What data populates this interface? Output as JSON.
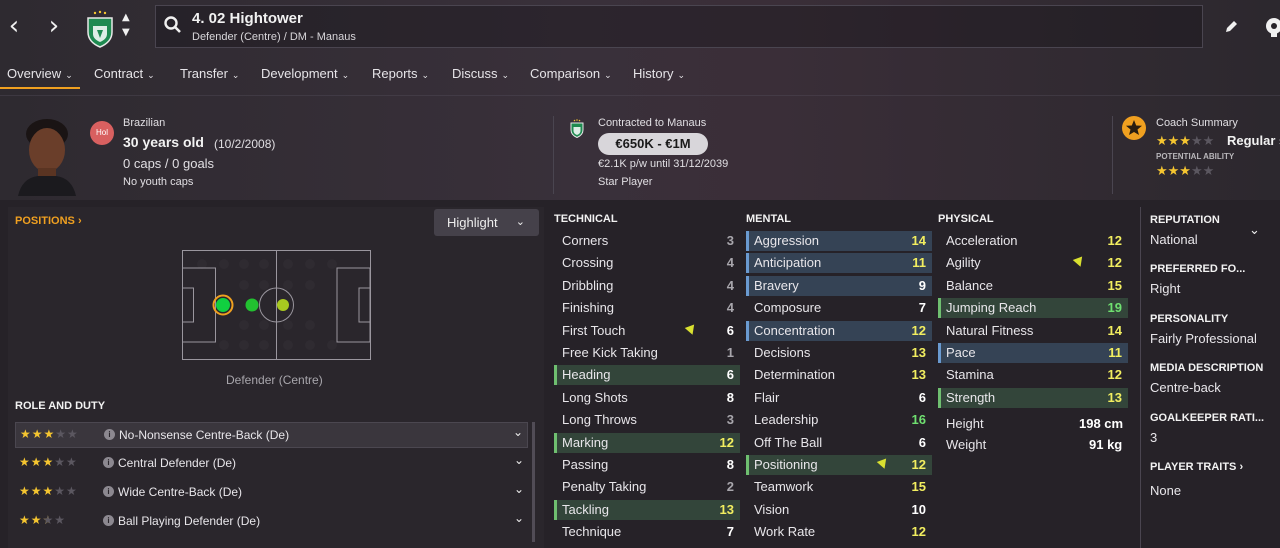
{
  "header": {
    "player_title": "4. 02 Hightower",
    "player_subtitle": "Defender (Centre) / DM - Manaus",
    "back_icon": "chevron-left-icon",
    "forward_icon": "chevron-right-icon"
  },
  "menu": {
    "items": [
      {
        "label": "Overview"
      },
      {
        "label": "Contract"
      },
      {
        "label": "Transfer"
      },
      {
        "label": "Development"
      },
      {
        "label": "Reports"
      },
      {
        "label": "Discuss"
      },
      {
        "label": "Comparison"
      },
      {
        "label": "History"
      }
    ],
    "active": "Overview"
  },
  "profile": {
    "nationality": "Brazilian",
    "nation_badge": "Hol",
    "age": "30 years old",
    "dob": "(10/2/2008)",
    "caps": "0 caps / 0 goals",
    "youth": "No youth caps"
  },
  "contract": {
    "heading": "Contracted to Manaus",
    "value": "€650K - €1M",
    "wage": "€2.1K p/w until 31/12/2039",
    "status": "Star Player"
  },
  "coach": {
    "heading": "Coach Summary",
    "ability_stars": 3,
    "ability_label": "Regular s",
    "potential_heading": "POTENTIAL ABILITY",
    "potential_stars": 3
  },
  "positions": {
    "heading": "POSITIONS",
    "highlight_label": "Highlight",
    "pitch_caption": "Defender (Centre)",
    "marker_colors": {
      "natural": "#10d040",
      "accomplished": "#22c030",
      "competent": "#a8c820"
    }
  },
  "roles": {
    "heading": "ROLE AND DUTY",
    "items": [
      {
        "label": "No-Nonsense Centre-Back (De)",
        "stars": 3
      },
      {
        "label": "Central Defender (De)",
        "stars": 3
      },
      {
        "label": "Wide Centre-Back (De)",
        "stars": 3
      },
      {
        "label": "Ball Playing Defender (De)",
        "stars": 2.5
      }
    ]
  },
  "technical": {
    "heading": "TECHNICAL",
    "items": [
      {
        "name": "Corners",
        "value": "3"
      },
      {
        "name": "Crossing",
        "value": "4"
      },
      {
        "name": "Dribbling",
        "value": "4"
      },
      {
        "name": "Finishing",
        "value": "4"
      },
      {
        "name": "First Touch",
        "value": "6"
      },
      {
        "name": "Free Kick Taking",
        "value": "1"
      },
      {
        "name": "Heading",
        "value": "6"
      },
      {
        "name": "Long Shots",
        "value": "8"
      },
      {
        "name": "Long Throws",
        "value": "3"
      },
      {
        "name": "Marking",
        "value": "12"
      },
      {
        "name": "Passing",
        "value": "8"
      },
      {
        "name": "Penalty Taking",
        "value": "2"
      },
      {
        "name": "Tackling",
        "value": "13"
      },
      {
        "name": "Technique",
        "value": "7"
      }
    ]
  },
  "mental": {
    "heading": "MENTAL",
    "items": [
      {
        "name": "Aggression",
        "value": "14"
      },
      {
        "name": "Anticipation",
        "value": "11"
      },
      {
        "name": "Bravery",
        "value": "9"
      },
      {
        "name": "Composure",
        "value": "7"
      },
      {
        "name": "Concentration",
        "value": "12"
      },
      {
        "name": "Decisions",
        "value": "13"
      },
      {
        "name": "Determination",
        "value": "13"
      },
      {
        "name": "Flair",
        "value": "6"
      },
      {
        "name": "Leadership",
        "value": "16"
      },
      {
        "name": "Off The Ball",
        "value": "6"
      },
      {
        "name": "Positioning",
        "value": "12"
      },
      {
        "name": "Teamwork",
        "value": "15"
      },
      {
        "name": "Vision",
        "value": "10"
      },
      {
        "name": "Work Rate",
        "value": "12"
      }
    ]
  },
  "physical": {
    "heading": "PHYSICAL",
    "items": [
      {
        "name": "Acceleration",
        "value": "12"
      },
      {
        "name": "Agility",
        "value": "12"
      },
      {
        "name": "Balance",
        "value": "15"
      },
      {
        "name": "Jumping Reach",
        "value": "19"
      },
      {
        "name": "Natural Fitness",
        "value": "14"
      },
      {
        "name": "Pace",
        "value": "11"
      },
      {
        "name": "Stamina",
        "value": "12"
      },
      {
        "name": "Strength",
        "value": "13"
      }
    ],
    "height_label": "Height",
    "height": "198 cm",
    "weight_label": "Weight",
    "weight": "91 kg"
  },
  "side": {
    "reputation_h": "REPUTATION",
    "reputation": "National",
    "foot_h": "PREFERRED FO...",
    "foot": "Right",
    "personality_h": "PERSONALITY",
    "personality": "Fairly Professional",
    "media_h": "MEDIA DESCRIPTION",
    "media": "Centre-back",
    "gk_h": "GOALKEEPER RATI...",
    "gk": "3",
    "traits_h": "PLAYER TRAITS",
    "traits": "None"
  },
  "colors": {
    "accent": "#f0a020",
    "value_white": "#ffffff",
    "value_grey": "#a8a6ac",
    "value_yellow": "#f2ee60",
    "value_green": "#6fe070",
    "highlight_blue": "#354355",
    "highlight_green": "#33453a"
  }
}
